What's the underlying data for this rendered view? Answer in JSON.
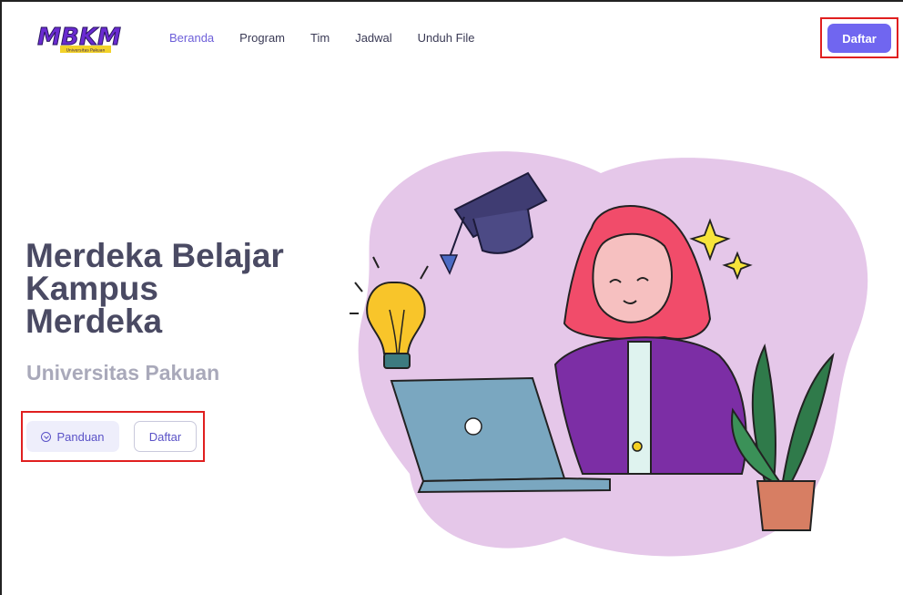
{
  "brand": {
    "logo_text": "MBKM",
    "logo_subtext": "Universitas Pakuan"
  },
  "nav": {
    "links": [
      "Beranda",
      "Program",
      "Tim",
      "Jadwal",
      "Unduh File"
    ],
    "active": "Beranda",
    "cta_label": "Daftar"
  },
  "hero": {
    "title_lines": [
      "Merdeka Belajar",
      "Kampus",
      "Merdeka"
    ],
    "subtitle": "Universitas Pakuan",
    "primary_button": "Panduan",
    "secondary_button": "Daftar"
  },
  "colors": {
    "accent": "#7066f0",
    "title": "#4a4a63",
    "subtitle": "#a9a9ba",
    "highlight_box": "#e01f1f"
  }
}
